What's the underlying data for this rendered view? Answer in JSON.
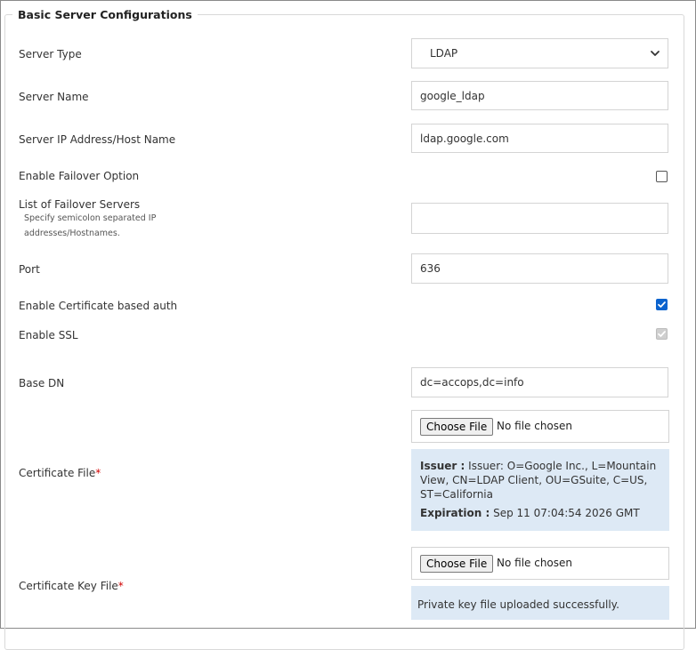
{
  "section": {
    "title": "Basic Server Configurations"
  },
  "server_type": {
    "label": "Server Type",
    "value": "LDAP"
  },
  "server_name": {
    "label": "Server Name",
    "value": "google_ldap"
  },
  "server_ip": {
    "label": "Server IP Address/Host Name",
    "value": "ldap.google.com"
  },
  "failover_option": {
    "label": "Enable Failover Option",
    "checked": false
  },
  "failover_servers": {
    "label": "List of Failover Servers",
    "hint_line1": "Specify semicolon separated IP",
    "hint_line2": "addresses/Hostnames.",
    "value": ""
  },
  "port": {
    "label": "Port",
    "value": "636"
  },
  "cert_auth": {
    "label": "Enable Certificate based auth",
    "checked": true
  },
  "ssl": {
    "label": "Enable SSL",
    "checked": true,
    "disabled": true
  },
  "base_dn": {
    "label": "Base DN",
    "value": "dc=accops,dc=info"
  },
  "cert_file": {
    "label": "Certificate File",
    "required_mark": "*",
    "button": "Choose File",
    "status": "No file chosen",
    "issuer_label": "Issuer :",
    "issuer_line1": "Issuer: O=Google Inc., L=Mountain",
    "issuer_line2": "View, CN=LDAP Client, OU=GSuite, C=US,",
    "issuer_line3": "ST=California",
    "expiration_label": "Expiration :",
    "expiration_value": "Sep 11 07:04:54 2026 GMT"
  },
  "cert_key_file": {
    "label": "Certificate Key File",
    "required_mark": "*",
    "button": "Choose File",
    "status": "No file chosen",
    "message": "Private key file uploaded successfully."
  },
  "colors": {
    "accent": "#0b63ce",
    "info_bg": "#dde9f5",
    "required": "#d00000"
  },
  "icons": {
    "select": "chevron-down-icon",
    "check": "checkmark-icon"
  }
}
